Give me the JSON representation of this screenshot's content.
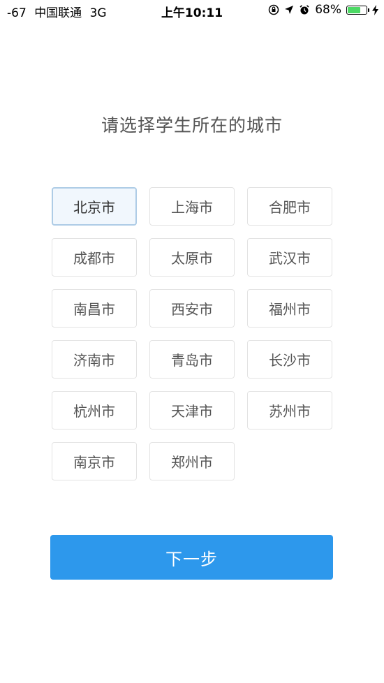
{
  "status_bar": {
    "signal": "-67",
    "carrier": "中国联通",
    "network": "3G",
    "time": "上午10:11",
    "battery_percent": "68%",
    "battery_level": 0.68,
    "icons": [
      "rotation-lock-icon",
      "location-arrow-icon",
      "alarm-icon",
      "battery-icon",
      "charging-bolt-icon"
    ]
  },
  "title": "请选择学生所在的城市",
  "cities": {
    "items": [
      "北京市",
      "上海市",
      "合肥市",
      "成都市",
      "太原市",
      "武汉市",
      "南昌市",
      "西安市",
      "福州市",
      "济南市",
      "青岛市",
      "长沙市",
      "杭州市",
      "天津市",
      "苏州市",
      "南京市",
      "郑州市"
    ],
    "selected": "北京市"
  },
  "next_button": {
    "label": "下一步",
    "color": "#2d98ec"
  },
  "colors": {
    "selected_border": "#aecce6",
    "selected_bg": "#f1f7fd",
    "battery": "#4cd964"
  }
}
